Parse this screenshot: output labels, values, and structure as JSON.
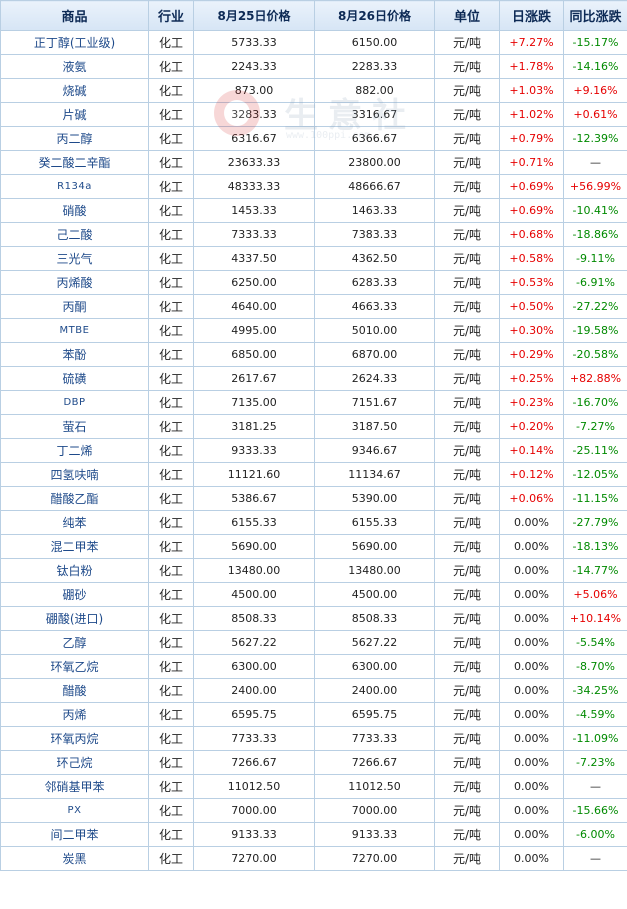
{
  "headers": {
    "product": "商品",
    "industry": "行业",
    "price_aug25": "8月25日价格",
    "price_aug26": "8月26日价格",
    "unit": "单位",
    "daily_change": "日涨跌",
    "yoy_change": "同比涨跌"
  },
  "watermark": {
    "text": "生意社",
    "url": "www.100ppi.com"
  },
  "colors": {
    "up": "#e60000",
    "down": "#008a00",
    "header_text": "#0d2a55",
    "border": "#b9cfe3"
  },
  "rows": [
    {
      "name": "正丁醇(工业级)",
      "industry": "化工",
      "p1": "5733.33",
      "p2": "6150.00",
      "unit": "元/吨",
      "day": "+7.27%",
      "yoy": "-15.17%"
    },
    {
      "name": "液氨",
      "industry": "化工",
      "p1": "2243.33",
      "p2": "2283.33",
      "unit": "元/吨",
      "day": "+1.78%",
      "yoy": "-14.16%"
    },
    {
      "name": "烧碱",
      "industry": "化工",
      "p1": "873.00",
      "p2": "882.00",
      "unit": "元/吨",
      "day": "+1.03%",
      "yoy": "+9.16%"
    },
    {
      "name": "片碱",
      "industry": "化工",
      "p1": "3283.33",
      "p2": "3316.67",
      "unit": "元/吨",
      "day": "+1.02%",
      "yoy": "+0.61%"
    },
    {
      "name": "丙二醇",
      "industry": "化工",
      "p1": "6316.67",
      "p2": "6366.67",
      "unit": "元/吨",
      "day": "+0.79%",
      "yoy": "-12.39%"
    },
    {
      "name": "癸二酸二辛酯",
      "industry": "化工",
      "p1": "23633.33",
      "p2": "23800.00",
      "unit": "元/吨",
      "day": "+0.71%",
      "yoy": "—"
    },
    {
      "name": "R134a",
      "industry": "化工",
      "p1": "48333.33",
      "p2": "48666.67",
      "unit": "元/吨",
      "day": "+0.69%",
      "yoy": "+56.99%"
    },
    {
      "name": "硝酸",
      "industry": "化工",
      "p1": "1453.33",
      "p2": "1463.33",
      "unit": "元/吨",
      "day": "+0.69%",
      "yoy": "-10.41%"
    },
    {
      "name": "己二酸",
      "industry": "化工",
      "p1": "7333.33",
      "p2": "7383.33",
      "unit": "元/吨",
      "day": "+0.68%",
      "yoy": "-18.86%"
    },
    {
      "name": "三光气",
      "industry": "化工",
      "p1": "4337.50",
      "p2": "4362.50",
      "unit": "元/吨",
      "day": "+0.58%",
      "yoy": "-9.11%"
    },
    {
      "name": "丙烯酸",
      "industry": "化工",
      "p1": "6250.00",
      "p2": "6283.33",
      "unit": "元/吨",
      "day": "+0.53%",
      "yoy": "-6.91%"
    },
    {
      "name": "丙酮",
      "industry": "化工",
      "p1": "4640.00",
      "p2": "4663.33",
      "unit": "元/吨",
      "day": "+0.50%",
      "yoy": "-27.22%"
    },
    {
      "name": "MTBE",
      "industry": "化工",
      "p1": "4995.00",
      "p2": "5010.00",
      "unit": "元/吨",
      "day": "+0.30%",
      "yoy": "-19.58%"
    },
    {
      "name": "苯酚",
      "industry": "化工",
      "p1": "6850.00",
      "p2": "6870.00",
      "unit": "元/吨",
      "day": "+0.29%",
      "yoy": "-20.58%"
    },
    {
      "name": "硫磺",
      "industry": "化工",
      "p1": "2617.67",
      "p2": "2624.33",
      "unit": "元/吨",
      "day": "+0.25%",
      "yoy": "+82.88%"
    },
    {
      "name": "DBP",
      "industry": "化工",
      "p1": "7135.00",
      "p2": "7151.67",
      "unit": "元/吨",
      "day": "+0.23%",
      "yoy": "-16.70%"
    },
    {
      "name": "萤石",
      "industry": "化工",
      "p1": "3181.25",
      "p2": "3187.50",
      "unit": "元/吨",
      "day": "+0.20%",
      "yoy": "-7.27%"
    },
    {
      "name": "丁二烯",
      "industry": "化工",
      "p1": "9333.33",
      "p2": "9346.67",
      "unit": "元/吨",
      "day": "+0.14%",
      "yoy": "-25.11%"
    },
    {
      "name": "四氢呋喃",
      "industry": "化工",
      "p1": "11121.60",
      "p2": "11134.67",
      "unit": "元/吨",
      "day": "+0.12%",
      "yoy": "-12.05%"
    },
    {
      "name": "醋酸乙酯",
      "industry": "化工",
      "p1": "5386.67",
      "p2": "5390.00",
      "unit": "元/吨",
      "day": "+0.06%",
      "yoy": "-11.15%"
    },
    {
      "name": "纯苯",
      "industry": "化工",
      "p1": "6155.33",
      "p2": "6155.33",
      "unit": "元/吨",
      "day": "0.00%",
      "yoy": "-27.79%"
    },
    {
      "name": "混二甲苯",
      "industry": "化工",
      "p1": "5690.00",
      "p2": "5690.00",
      "unit": "元/吨",
      "day": "0.00%",
      "yoy": "-18.13%"
    },
    {
      "name": "钛白粉",
      "industry": "化工",
      "p1": "13480.00",
      "p2": "13480.00",
      "unit": "元/吨",
      "day": "0.00%",
      "yoy": "-14.77%"
    },
    {
      "name": "硼砂",
      "industry": "化工",
      "p1": "4500.00",
      "p2": "4500.00",
      "unit": "元/吨",
      "day": "0.00%",
      "yoy": "+5.06%"
    },
    {
      "name": "硼酸(进口)",
      "industry": "化工",
      "p1": "8508.33",
      "p2": "8508.33",
      "unit": "元/吨",
      "day": "0.00%",
      "yoy": "+10.14%"
    },
    {
      "name": "乙醇",
      "industry": "化工",
      "p1": "5627.22",
      "p2": "5627.22",
      "unit": "元/吨",
      "day": "0.00%",
      "yoy": "-5.54%"
    },
    {
      "name": "环氧乙烷",
      "industry": "化工",
      "p1": "6300.00",
      "p2": "6300.00",
      "unit": "元/吨",
      "day": "0.00%",
      "yoy": "-8.70%"
    },
    {
      "name": "醋酸",
      "industry": "化工",
      "p1": "2400.00",
      "p2": "2400.00",
      "unit": "元/吨",
      "day": "0.00%",
      "yoy": "-34.25%"
    },
    {
      "name": "丙烯",
      "industry": "化工",
      "p1": "6595.75",
      "p2": "6595.75",
      "unit": "元/吨",
      "day": "0.00%",
      "yoy": "-4.59%"
    },
    {
      "name": "环氧丙烷",
      "industry": "化工",
      "p1": "7733.33",
      "p2": "7733.33",
      "unit": "元/吨",
      "day": "0.00%",
      "yoy": "-11.09%"
    },
    {
      "name": "环己烷",
      "industry": "化工",
      "p1": "7266.67",
      "p2": "7266.67",
      "unit": "元/吨",
      "day": "0.00%",
      "yoy": "-7.23%"
    },
    {
      "name": "邻硝基甲苯",
      "industry": "化工",
      "p1": "11012.50",
      "p2": "11012.50",
      "unit": "元/吨",
      "day": "0.00%",
      "yoy": "—"
    },
    {
      "name": "PX",
      "industry": "化工",
      "p1": "7000.00",
      "p2": "7000.00",
      "unit": "元/吨",
      "day": "0.00%",
      "yoy": "-15.66%"
    },
    {
      "name": "间二甲苯",
      "industry": "化工",
      "p1": "9133.33",
      "p2": "9133.33",
      "unit": "元/吨",
      "day": "0.00%",
      "yoy": "-6.00%"
    },
    {
      "name": "炭黑",
      "industry": "化工",
      "p1": "7270.00",
      "p2": "7270.00",
      "unit": "元/吨",
      "day": "0.00%",
      "yoy": "—"
    }
  ]
}
